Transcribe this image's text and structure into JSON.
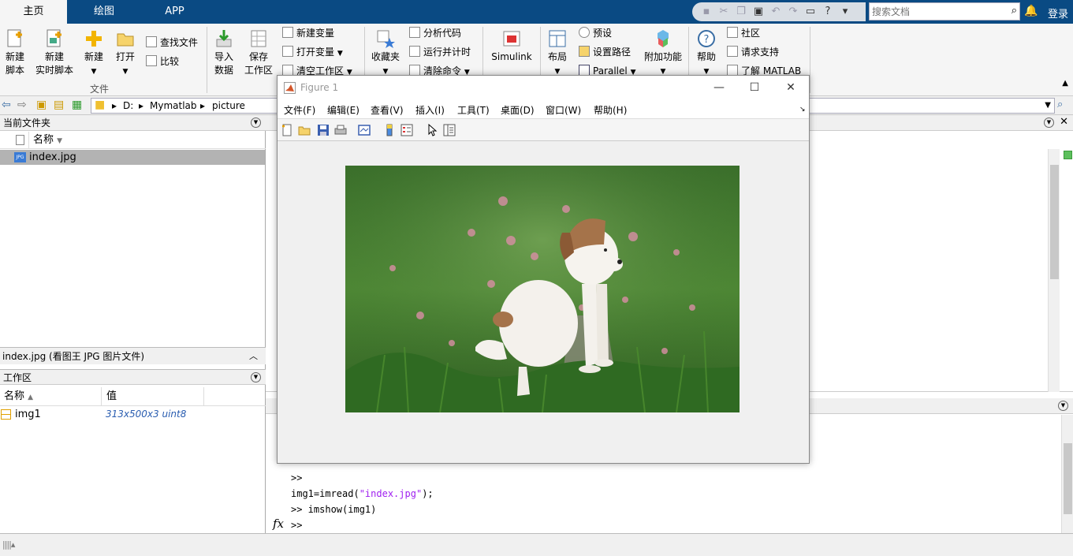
{
  "tabs": {
    "home": "主页",
    "plots": "绘图",
    "apps": "APP"
  },
  "search": {
    "placeholder": "搜索文档"
  },
  "login": "登录",
  "ribbon": {
    "new_script": "新建\n脚本",
    "new_live_script": "新建\n实时脚本",
    "new": "新建",
    "open": "打开",
    "find_files": "查找文件",
    "compare": "比较",
    "file_group": "文件",
    "import_data": "导入\n数据",
    "save_workspace": "保存\n工作区",
    "new_variable": "新建变量",
    "open_variable": "打开变量",
    "clear_workspace": "清空工作区",
    "favorites": "收藏夹",
    "analyze_code": "分析代码",
    "run_and_time": "运行并计时",
    "clear_commands": "清除命令",
    "simulink": "Simulink",
    "layout": "布局",
    "preferences": "预设",
    "set_path": "设置路径",
    "parallel": "Parallel",
    "addons": "附加功能",
    "help": "帮助",
    "community": "社区",
    "request_support": "请求支持",
    "learn_matlab": "了解 MATLAB"
  },
  "path": {
    "drive": "D:",
    "folder1": "Mymatlab",
    "folder2": "picture"
  },
  "current_folder": {
    "title": "当前文件夹",
    "col_name": "名称",
    "files": [
      {
        "name": "index.jpg"
      }
    ],
    "details": "index.jpg  (看图王 JPG 图片文件)"
  },
  "workspace": {
    "title": "工作区",
    "col_name": "名称",
    "col_value": "值",
    "vars": [
      {
        "name": "img1",
        "value": "313x500x3 uint8"
      }
    ]
  },
  "command_window": {
    "lines": [
      ">>",
      "img1=imread(",
      "\"index.jpg\"",
      ");",
      ">> imshow(img1)",
      ">>"
    ]
  },
  "figure": {
    "title": "Figure 1",
    "menu": [
      "文件(F)",
      "编辑(E)",
      "查看(V)",
      "插入(I)",
      "工具(T)",
      "桌面(D)",
      "窗口(W)",
      "帮助(H)"
    ]
  },
  "colors": {
    "topbar": "#0a4a83",
    "photo_grass": "#3f7d2c",
    "string": "#a020f0"
  }
}
